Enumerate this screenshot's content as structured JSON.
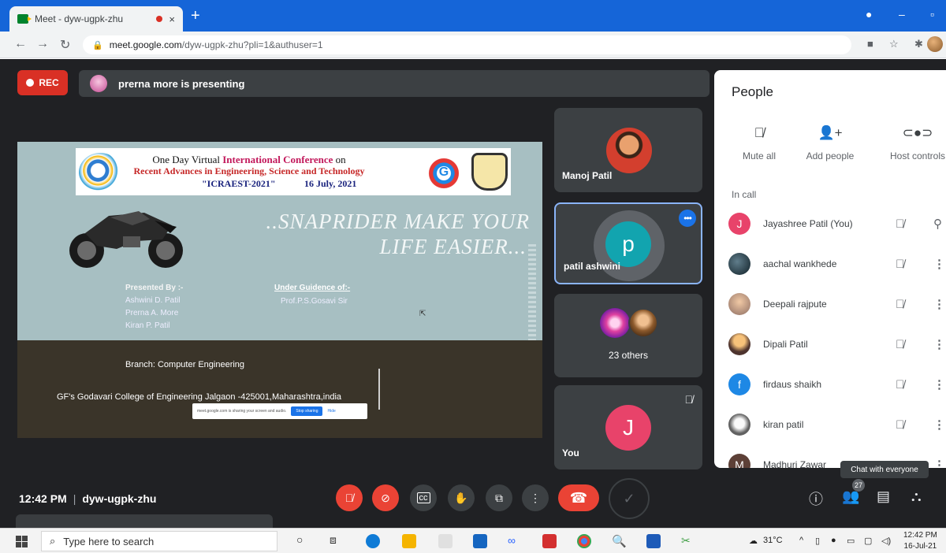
{
  "browser": {
    "tab_title": "Meet - dyw-ugpk-zhu",
    "tab_close": "×",
    "new_tab": "+",
    "url_main": "meet.google.com",
    "url_rest": "/dyw-ugpk-zhu?pli=1&authuser=1"
  },
  "meet": {
    "rec_label": "REC",
    "presenting_text": "prerna more is presenting",
    "meeting_time": "12:42 PM",
    "meeting_code": "dyw-ugpk-zhu"
  },
  "slide": {
    "line1_prefix": "One Day Virtual ",
    "line1_highlight": "International Conference",
    "line1_suffix": " on",
    "line2": "Recent Advances in Engineering, Science and Technology",
    "acronym": "\"ICRAEST-2021\"",
    "date": "16 July, 2021",
    "logo_letter": "G",
    "slogan_line1": "..SNAPRIDER MAKE YOUR",
    "slogan_line2": "LIFE EASIER...",
    "presented_by_heading": "Presented By :-",
    "presenters": [
      "Ashwini D. Patil",
      "Prerna A. More",
      "Kiran P. Patil"
    ],
    "guidance_heading": "Under Guidence of:-",
    "guide": "Prof.P.S.Gosavi Sir",
    "branch": "Branch: Computer Engineering",
    "college": "GF's Godavari College of Engineering Jalgaon -425001,Maharashtra,india",
    "share_text": "meet.google.com is sharing your screen and audio.",
    "stop_sharing": "Stop sharing",
    "hide": "Hide"
  },
  "tiles": {
    "manoj": "Manoj Patil",
    "ashwini": "patil ashwini",
    "ashwini_initial": "p",
    "others": "23 others",
    "you": "You",
    "you_initial": "J"
  },
  "people": {
    "title": "People",
    "mute_all": "Mute all",
    "add_people": "Add people",
    "host_controls": "Host controls",
    "in_call": "In call",
    "participants": [
      {
        "name": "Jayashree Patil (You)",
        "initial": "J",
        "color": "#e8436a"
      },
      {
        "name": "aachal wankhede",
        "initial": "",
        "color": "#263238"
      },
      {
        "name": "Deepali rajpute",
        "initial": "",
        "color": "#a1887f"
      },
      {
        "name": "Dipali Patil",
        "initial": "",
        "color": "#6d4c41"
      },
      {
        "name": "firdaus shaikh",
        "initial": "f",
        "color": "#1e88e5"
      },
      {
        "name": "kiran patil",
        "initial": "",
        "color": "#9e9e9e"
      },
      {
        "name": "Madhuri Zawar",
        "initial": "M",
        "color": "#5d4037"
      }
    ]
  },
  "controls": {
    "people_count": "27",
    "tooltip": "Chat with everyone"
  },
  "taskbar": {
    "search_placeholder": "Type here to search",
    "temperature": "31°C",
    "time": "12:42 PM",
    "date": "16-Jul-21"
  }
}
